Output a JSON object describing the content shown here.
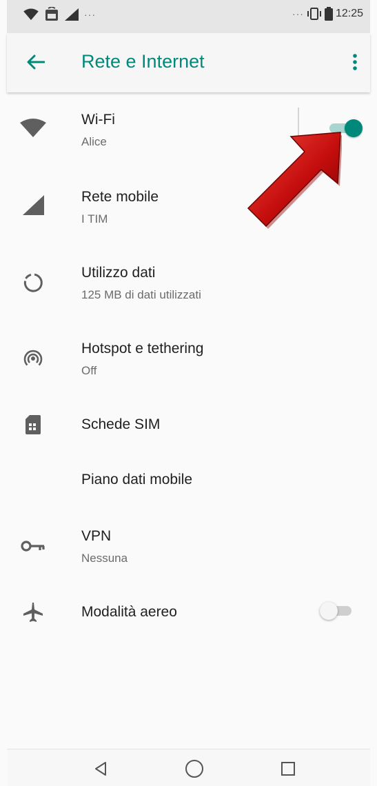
{
  "status_bar": {
    "time": "12:25",
    "overflow": "···",
    "icons": [
      "wifi-icon",
      "volte-icon",
      "signal-icon",
      "vibrate-icon",
      "battery-icon"
    ]
  },
  "app_bar": {
    "title": "Rete e Internet",
    "back_icon": "arrow-back-icon",
    "menu_icon": "more-vert-icon"
  },
  "settings": [
    {
      "id": "wifi",
      "title": "Wi-Fi",
      "subtitle": "Alice",
      "icon": "wifi-icon",
      "toggle": true
    },
    {
      "id": "mobile",
      "title": "Rete mobile",
      "subtitle": "I TIM",
      "icon": "signal-icon"
    },
    {
      "id": "data",
      "title": "Utilizzo dati",
      "subtitle": "125 MB di dati utilizzati",
      "icon": "data-usage-icon"
    },
    {
      "id": "hotspot",
      "title": "Hotspot e tethering",
      "subtitle": "Off",
      "icon": "hotspot-icon"
    },
    {
      "id": "sim",
      "title": "Schede SIM",
      "icon": "sim-card-icon"
    },
    {
      "id": "plan",
      "title": "Piano dati mobile"
    },
    {
      "id": "vpn",
      "title": "VPN",
      "subtitle": "Nessuna",
      "icon": "vpn-key-icon"
    },
    {
      "id": "airplane",
      "title": "Modalità aereo",
      "icon": "airplane-icon",
      "toggle": false
    }
  ],
  "nav_bar": [
    "back-triangle-icon",
    "home-circle-icon",
    "recents-square-icon"
  ],
  "colors": {
    "accent": "#00897b",
    "accent_light": "#a7d5cf",
    "text_primary": "#1f1f1f",
    "text_secondary": "#6b6b6b",
    "icon": "#5f5f5f",
    "arrow_red": "#c40d0d"
  }
}
